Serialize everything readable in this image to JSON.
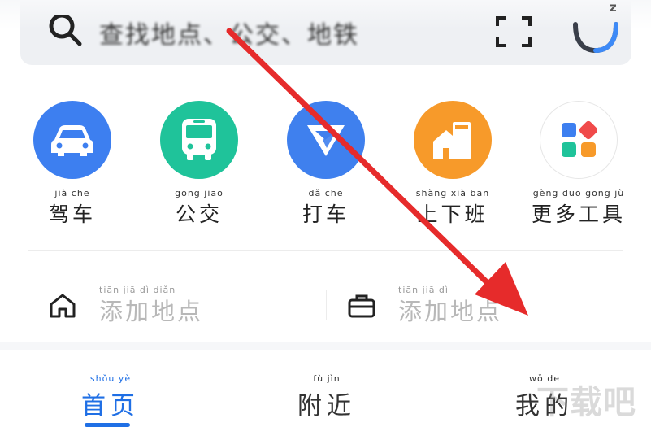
{
  "search": {
    "placeholder": "查找地点、公交、地铁",
    "voice_badge": "z"
  },
  "entries": [
    {
      "pinyin": "jià  chē",
      "label": "驾车",
      "color": "#3d7ff0",
      "icon": "car-icon"
    },
    {
      "pinyin": "gōng  jiāo",
      "label": "公交",
      "color": "#1fc39a",
      "icon": "bus-icon"
    },
    {
      "pinyin": "dǎ  chē",
      "label": "打车",
      "color": "#3f80ee",
      "icon": "taxi-icon"
    },
    {
      "pinyin": "shàng  xià  bān",
      "label": "上下班",
      "color": "#f79a2a",
      "icon": "commute-icon"
    },
    {
      "pinyin": "gèng  duō  gōng  jù",
      "label": "更多工具",
      "color": "#ffffff",
      "icon": "more-tools-icon"
    }
  ],
  "places": {
    "home": {
      "pinyin": "tiān  jiā  dì  diǎn",
      "label": "添加地点",
      "icon": "home-icon"
    },
    "work": {
      "pinyin": "tiān  jiā  dì",
      "label": "添加地点",
      "icon": "briefcase-icon"
    }
  },
  "nav": {
    "home": {
      "pinyin": "shǒu  yè",
      "label": "首页",
      "active_color": "#1f6fe5"
    },
    "nearby": {
      "pinyin": "fù  jìn",
      "label": "附近"
    },
    "mine": {
      "pinyin": "wǒ  de",
      "label": "我的"
    }
  },
  "watermark": "下载吧",
  "annotation": {
    "arrow_color": "#e62b2b"
  }
}
